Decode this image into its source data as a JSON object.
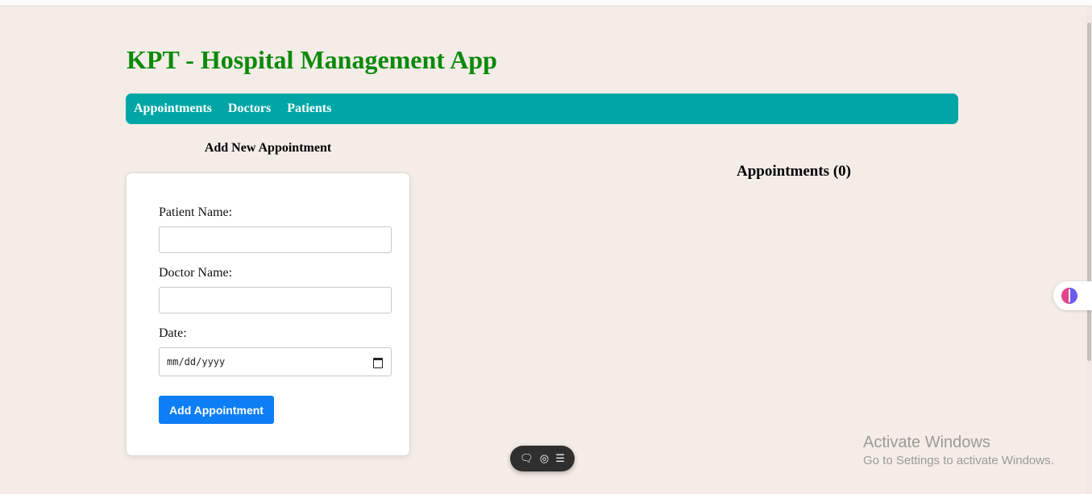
{
  "app": {
    "title": "KPT - Hospital Management App"
  },
  "nav": {
    "items": [
      {
        "label": "Appointments"
      },
      {
        "label": "Doctors"
      },
      {
        "label": "Patients"
      }
    ]
  },
  "form": {
    "heading": "Add New Appointment",
    "patient_label": "Patient Name:",
    "patient_value": "",
    "doctor_label": "Doctor Name:",
    "doctor_value": "",
    "date_label": "Date:",
    "date_placeholder": "mm/dd/yyyy",
    "submit_label": "Add Appointment"
  },
  "appointments": {
    "heading": "Appointments (0)"
  },
  "toolbar": {
    "icons": [
      "chat-icon",
      "screenshot-icon",
      "menu-icon"
    ]
  },
  "side_widget": {
    "icon": "brain-icon"
  },
  "watermark": {
    "title": "Activate Windows",
    "subtitle": "Go to Settings to activate Windows."
  },
  "colors": {
    "title": "#0a8a0a",
    "navbar": "#00a6a6",
    "button": "#0d7ef5",
    "background": "#f4ece7"
  }
}
